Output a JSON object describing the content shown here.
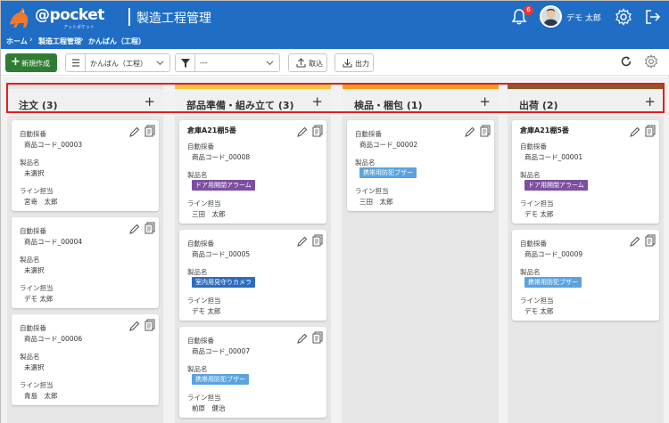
{
  "header": {
    "logo_text": "@pocket",
    "logo_sub": "アットポケット",
    "title": "製造工程管理",
    "notification_count": "6",
    "user_name": "デモ 太郎",
    "color": "#1f6dc5"
  },
  "breadcrumb": [
    "ホーム",
    "製造工程管理",
    "かんばん（工程）"
  ],
  "toolbar": {
    "new_label": "新規作成",
    "view_select": "かんばん（工程）",
    "filter_select": "---",
    "import_label": "取込",
    "export_label": "出力",
    "new_color": "#2e7d32"
  },
  "columns": [
    {
      "title": "注文 (3)",
      "accent": "#e6e6e6",
      "cards": [
        {
          "f1": "自動採番",
          "v1": "商品コード_00003",
          "f2": "製品名",
          "v2": "未選択",
          "f3": "ライン担当",
          "v3": "宮嵜　太郎"
        },
        {
          "f1": "自動採番",
          "v1": "商品コード_00004",
          "f2": "製品名",
          "v2": "未選択",
          "f3": "ライン担当",
          "v3": "デモ 太郎"
        },
        {
          "f1": "自動採番",
          "v1": "商品コード_00006",
          "f2": "製品名",
          "v2": "未選択",
          "f3": "ライン担当",
          "v3": "青島　太郎"
        }
      ]
    },
    {
      "title": "部品準備・組み立て (3)",
      "accent": "#f5c242",
      "cards": [
        {
          "loc": "倉庫A21棚5番",
          "f1": "自動採番",
          "v1": "商品コード_00008",
          "f2": "製品名",
          "tag": "ドア用開閉アラーム",
          "f3": "ライン担当",
          "v3": "三田　太郎"
        },
        {
          "f1": "自動採番",
          "v1": "商品コード_00005",
          "f2": "製品名",
          "tag": "室内用見守りカメラ",
          "f3": "ライン担当",
          "v3": "デモ 太郎"
        },
        {
          "f1": "自動採番",
          "v1": "商品コード_00007",
          "f2": "製品名",
          "tag": "携帯用防犯ブザー",
          "f3": "ライン担当",
          "v3": "前原　健治"
        }
      ]
    },
    {
      "title": "検品・梱包 (1)",
      "accent": "#f29a1e",
      "cards": [
        {
          "f1": "自動採番",
          "v1": "商品コード_00002",
          "f2": "製品名",
          "tag": "携帯用防犯ブザー",
          "f3": "ライン担当",
          "v3": "三田　太郎"
        }
      ]
    },
    {
      "title": "出荷 (2)",
      "accent": "#8b5a2b",
      "cards": [
        {
          "loc": "倉庫A21棚5番",
          "f1": "自動採番",
          "v1": "商品コード_00001",
          "f2": "製品名",
          "tag": "ドア用開閉アラーム",
          "f3": "ライン担当",
          "v3": "デモ 太郎"
        },
        {
          "f1": "自動採番",
          "v1": "商品コード_00009",
          "f2": "製品名",
          "tag": "携帯用防犯ブザー",
          "f3": "ライン担当",
          "v3": "デモ 太郎"
        }
      ]
    }
  ],
  "tag_colors": {
    "ドア用開閉アラーム": "#7d4fa0",
    "室内用見守りカメラ": "#2e6bbf",
    "携帯用防犯ブザー": "#5aa3e0"
  }
}
